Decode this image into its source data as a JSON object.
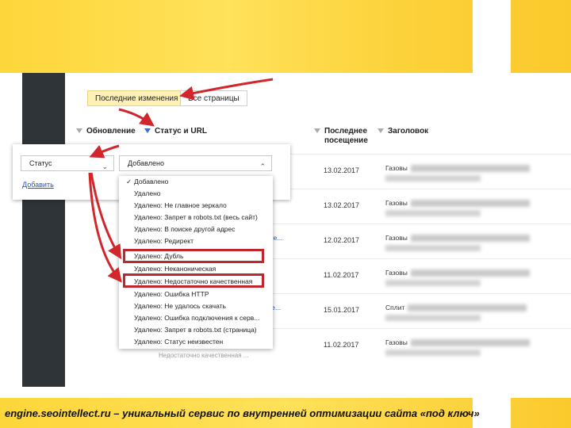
{
  "tabs": [
    {
      "label": "Последние изменения",
      "active": true
    },
    {
      "label": "Все страницы",
      "active": false
    }
  ],
  "columns": {
    "update": "Обновление",
    "status_url": "Статус и URL",
    "last_visit_line1": "Последнее",
    "last_visit_line2": "посещение",
    "title": "Заголовок"
  },
  "filter": {
    "field_value": "Статус",
    "status_value": "Добавлено",
    "add_link": "Добавить"
  },
  "dropdown_options": [
    "Добавлено",
    "Удалено",
    "Удалено: Не главное зеркало",
    "Удалено: Запрет в robots.txt (весь сайт)",
    "Удалено: В поиске другой адрес",
    "Удалено: Редирект",
    "Удалено: Дубль",
    "Удалено: Неканоническая",
    "Удалено: Недостаточно качественная",
    "Удалено: Ошибка HTTP",
    "Удалено: Не удалось скачать",
    "Удалено: Ошибка подключения к серв...",
    "Удалено: Запрет в robots.txt (страница)",
    "Удалено: Статус неизвестен"
  ],
  "rows": [
    {
      "date": "13.02.2017",
      "title": "Газовы",
      "url": ""
    },
    {
      "date": "13.02.2017",
      "title": "Газовы",
      "url": ""
    },
    {
      "date": "12.02.2017",
      "title": "Газовы",
      "url": "nle..."
    },
    {
      "date": "11.02.2017",
      "title": "Газовы",
      "url": ""
    },
    {
      "date": "15.01.2017",
      "title": "Сплит",
      "url": "ye..."
    },
    {
      "date": "11.02.2017",
      "title": "Газовы",
      "url": ""
    }
  ],
  "footer_row_text": "Недостаточно качественная ...",
  "caption": "engine.seointellect.ru – уникальный сервис по внутренней оптимизации сайта «под ключ»",
  "colors": {
    "accent_yellow": "#fdd63a",
    "highlight_red": "#c0272d",
    "arrow_red": "#d1262b",
    "sidebar": "#2f3439"
  }
}
